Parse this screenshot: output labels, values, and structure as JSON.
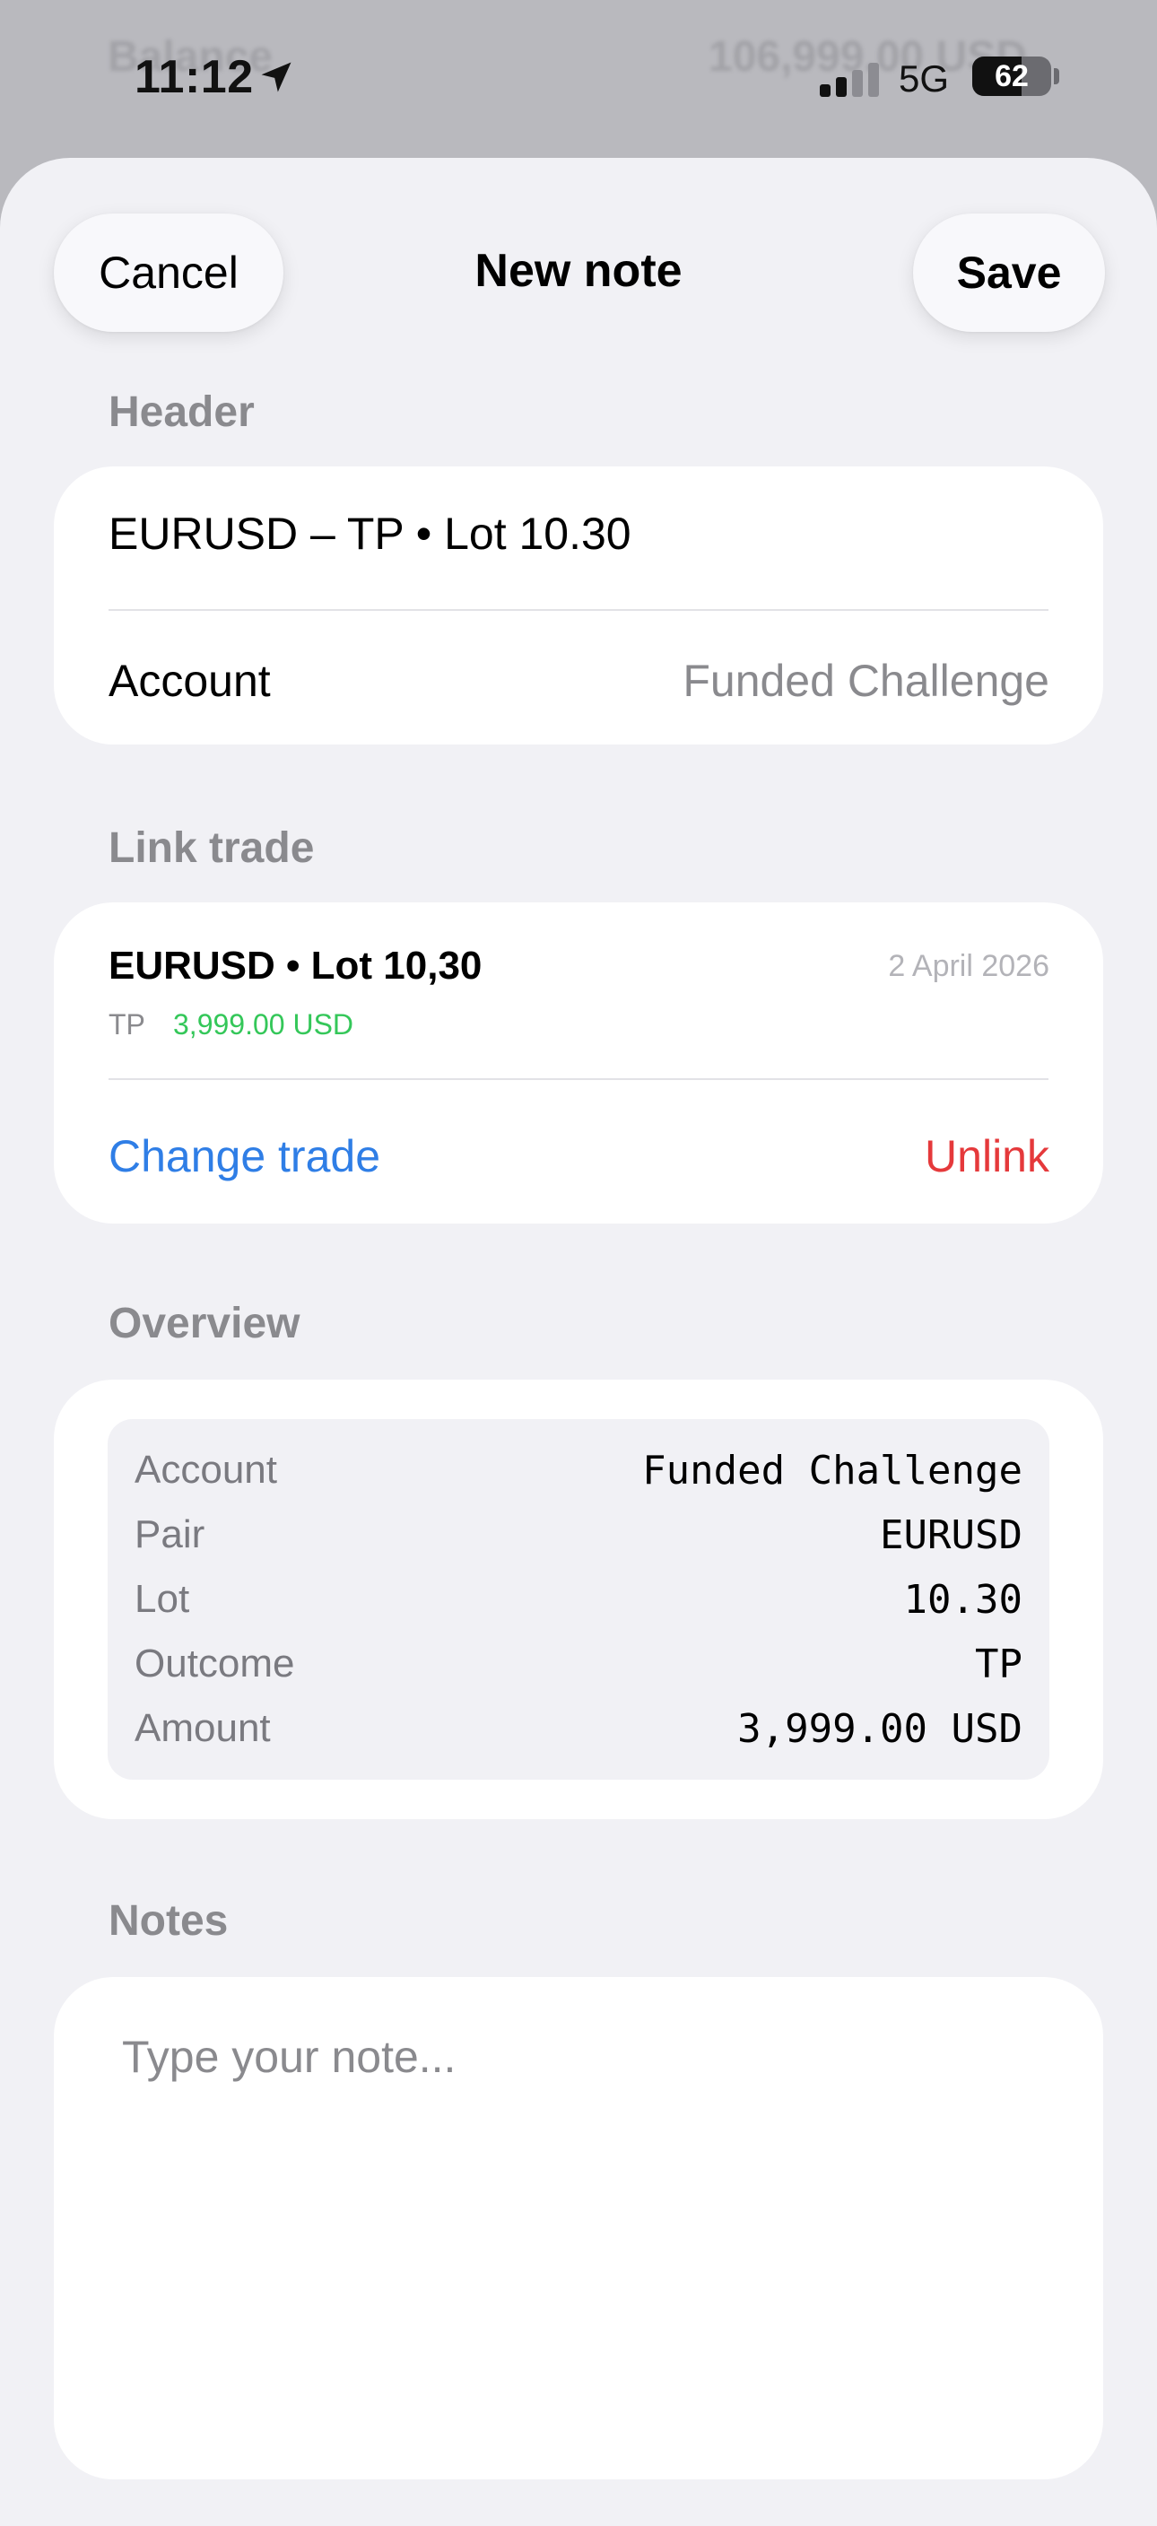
{
  "status_bar": {
    "time": "11:12",
    "network": "5G",
    "battery_level": 62,
    "battery_text": "62",
    "location_icon": "location-arrow-icon",
    "signal_icon": "cellular-signal-icon",
    "signal_bars_active": 2,
    "behind_sheet_left": "Balance",
    "behind_sheet_right": "106,999.00 USD"
  },
  "nav": {
    "cancel_label": "Cancel",
    "title": "New note",
    "save_label": "Save"
  },
  "header_section": {
    "label": "Header",
    "title_value": "EURUSD – TP • Lot 10.30",
    "account_label": "Account",
    "account_value": "Funded Challenge"
  },
  "link_trade_section": {
    "label": "Link trade",
    "trade_title": "EURUSD • Lot 10,30",
    "trade_date": "2 April 2026",
    "trade_outcome": "TP",
    "trade_amount": "3,999.00 USD",
    "change_label": "Change trade",
    "unlink_label": "Unlink"
  },
  "overview_section": {
    "label": "Overview",
    "rows": [
      {
        "label": "Account",
        "value": "Funded Challenge"
      },
      {
        "label": "Pair",
        "value": "EURUSD"
      },
      {
        "label": "Lot",
        "value": "10.30"
      },
      {
        "label": "Outcome",
        "value": "TP"
      },
      {
        "label": "Amount",
        "value": "3,999.00 USD"
      }
    ]
  },
  "notes_section": {
    "label": "Notes",
    "placeholder": "Type your note..."
  },
  "colors": {
    "accent_blue": "#2f7ee6",
    "destructive_red": "#e5393b",
    "positive_green": "#34c759",
    "secondary_text": "#8a8a8e",
    "sheet_background": "#f1f1f5"
  }
}
